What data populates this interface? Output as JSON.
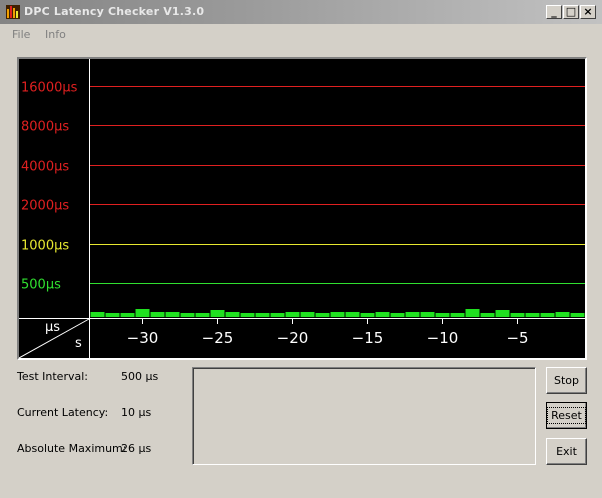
{
  "window": {
    "title": "DPC Latency Checker V1.3.0",
    "controls": {
      "minimize": "_",
      "maximize": "□",
      "close": "×"
    }
  },
  "menu": {
    "file": "File",
    "info": "Info"
  },
  "graph": {
    "background": "#000000",
    "y_unit_label": "µs",
    "x_unit_label": "s",
    "thresholds": [
      {
        "label": "16000µs",
        "value": 16000,
        "color": "#e02020"
      },
      {
        "label": "8000µs",
        "value": 8000,
        "color": "#e02020"
      },
      {
        "label": "4000µs",
        "value": 4000,
        "color": "#e02020"
      },
      {
        "label": "2000µs",
        "value": 2000,
        "color": "#e02020"
      },
      {
        "label": "1000µs",
        "value": 1000,
        "color": "#e8e830"
      },
      {
        "label": "500µs",
        "value": 500,
        "color": "#30e030"
      }
    ],
    "x_ticks": [
      {
        "label": "−30",
        "value": -30
      },
      {
        "label": "−25",
        "value": -25
      },
      {
        "label": "−20",
        "value": -20
      },
      {
        "label": "−15",
        "value": -15
      },
      {
        "label": "−10",
        "value": -10
      },
      {
        "label": "−5",
        "value": -5
      }
    ]
  },
  "chart_data": {
    "type": "bar",
    "xlabel": "s",
    "ylabel": "µs",
    "x_range": [
      -33,
      0
    ],
    "y_scale": "log",
    "bar_color": "#20e020",
    "x": [
      -33,
      -32,
      -31,
      -30,
      -29,
      -28,
      -27,
      -26,
      -25,
      -24,
      -23,
      -22,
      -21,
      -20,
      -19,
      -18,
      -17,
      -16,
      -15,
      -14,
      -13,
      -12,
      -11,
      -10,
      -9,
      -8,
      -7,
      -6,
      -5,
      -4,
      -3,
      -2,
      -1
    ],
    "values": [
      10,
      8,
      8,
      16,
      10,
      10,
      8,
      8,
      14,
      10,
      8,
      8,
      8,
      10,
      10,
      8,
      10,
      10,
      8,
      10,
      8,
      10,
      10,
      8,
      8,
      16,
      8,
      14,
      8,
      8,
      8,
      10,
      8,
      10
    ]
  },
  "stats": {
    "test_interval_label": "Test Interval:",
    "test_interval_value": "500 µs",
    "current_latency_label": "Current Latency:",
    "current_latency_value": "10 µs",
    "absolute_maximum_label": "Absolute Maximum:",
    "absolute_maximum_value": "26 µs"
  },
  "buttons": {
    "stop": "Stop",
    "reset": "Reset",
    "exit": "Exit"
  }
}
